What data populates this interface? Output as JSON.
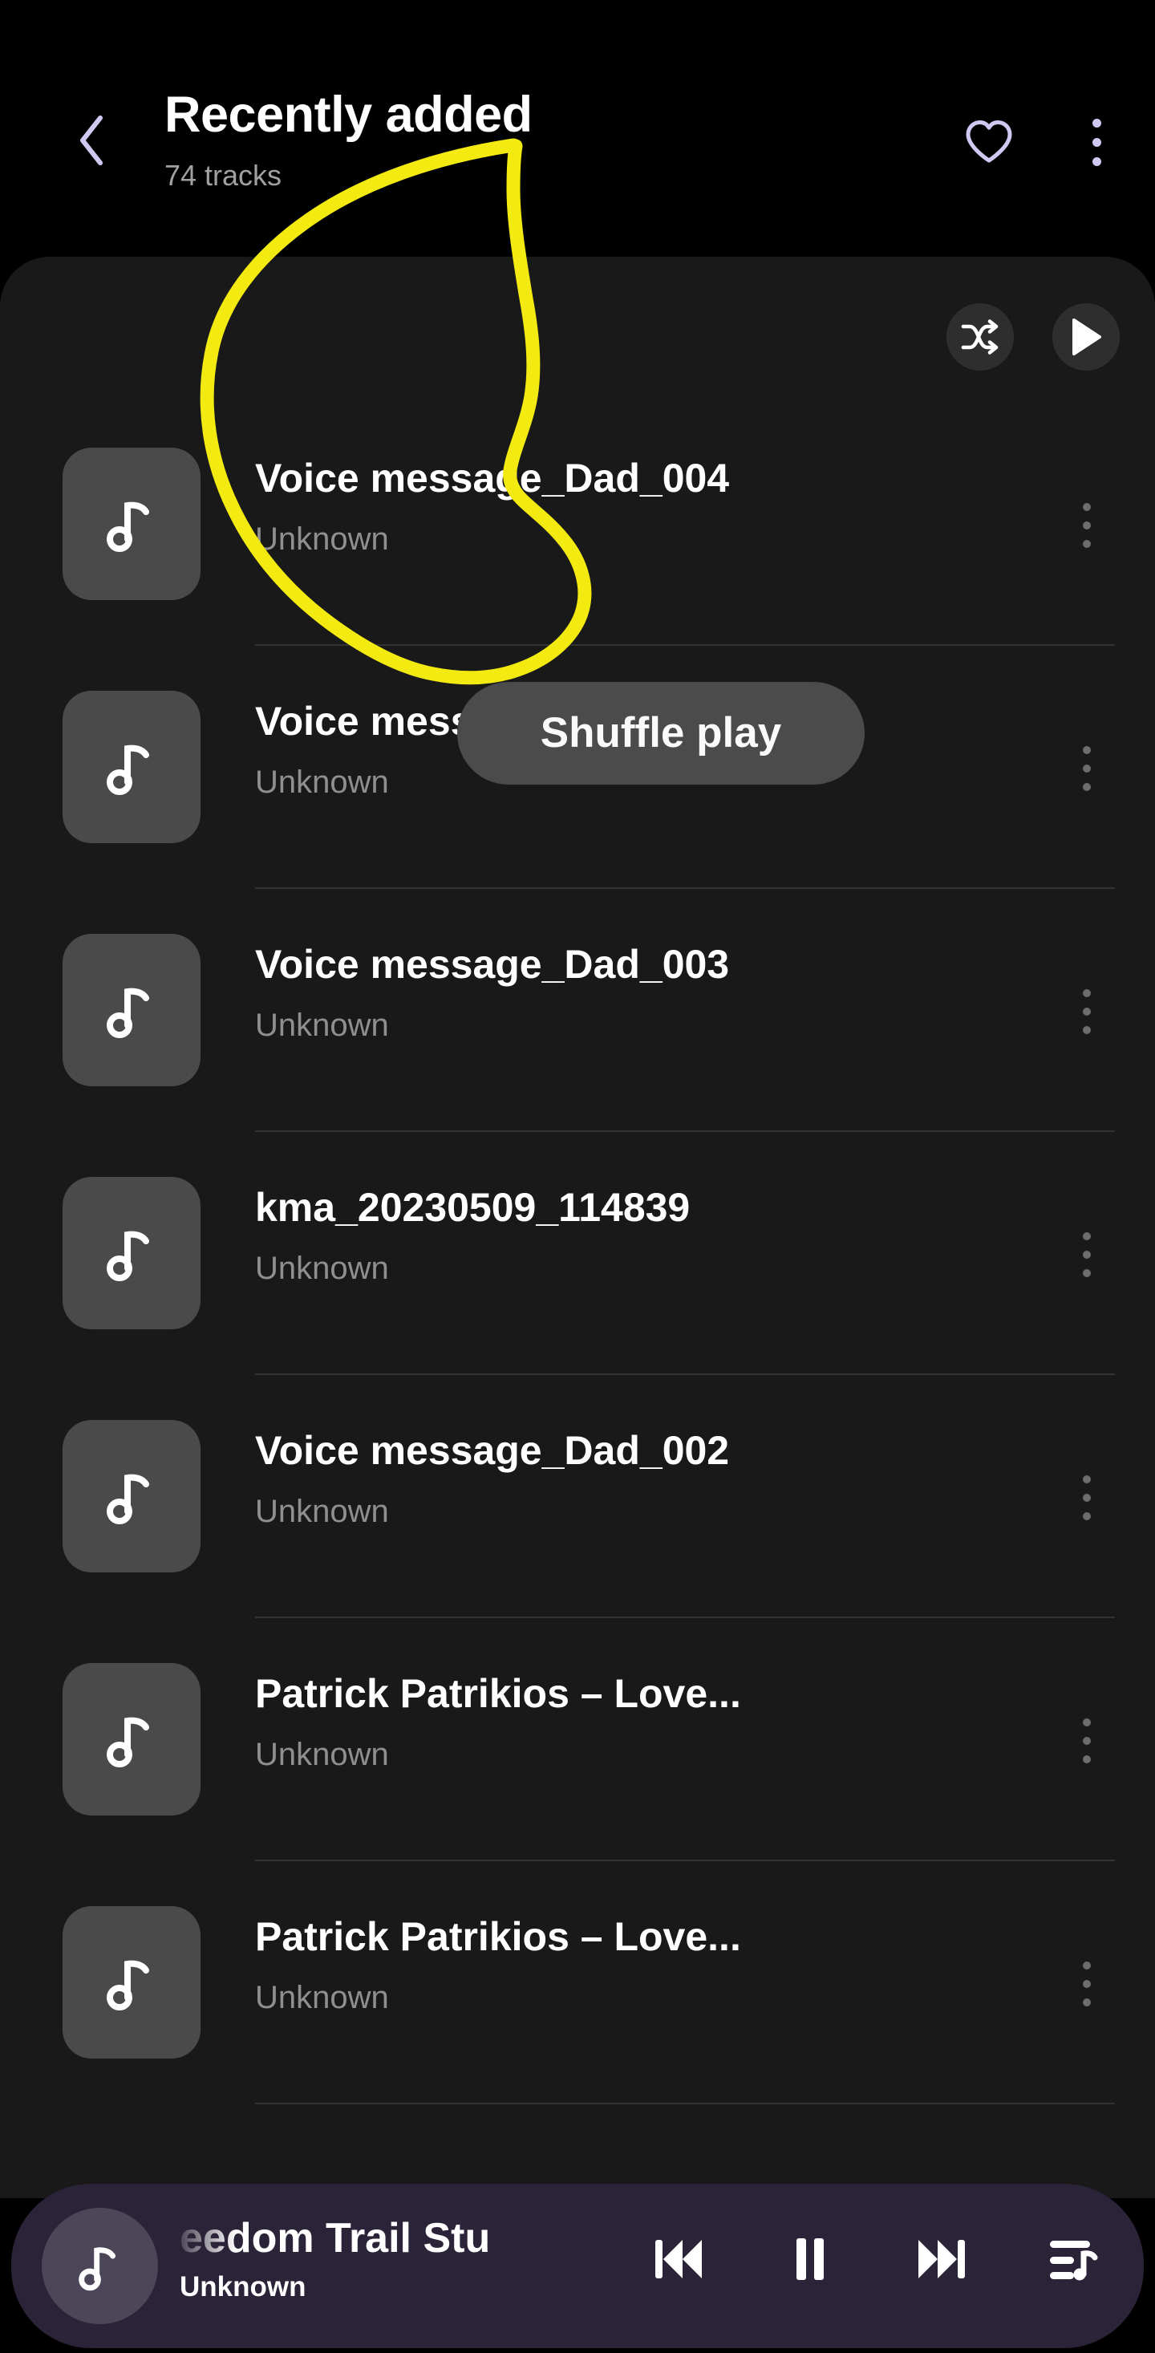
{
  "header": {
    "back_icon": "chevron-left-icon",
    "title": "Recently added",
    "subtitle": "74 tracks",
    "favorite_icon": "heart-outline-icon",
    "overflow_icon": "more-vertical-icon"
  },
  "card_actions": {
    "shuffle_icon": "shuffle-icon",
    "play_icon": "play-icon"
  },
  "tooltip": {
    "label": "Shuffle play"
  },
  "tracks": [
    {
      "title": "Voice message_Dad_004",
      "artist": "Unknown",
      "thumb_icon": "music-note-icon",
      "menu_icon": "more-vertical-icon"
    },
    {
      "title": "Voice message_New co...",
      "artist": "Unknown",
      "thumb_icon": "music-note-icon",
      "menu_icon": "more-vertical-icon"
    },
    {
      "title": "Voice message_Dad_003",
      "artist": "Unknown",
      "thumb_icon": "music-note-icon",
      "menu_icon": "more-vertical-icon"
    },
    {
      "title": "kma_20230509_114839",
      "artist": "Unknown",
      "thumb_icon": "music-note-icon",
      "menu_icon": "more-vertical-icon"
    },
    {
      "title": "Voice message_Dad_002",
      "artist": "Unknown",
      "thumb_icon": "music-note-icon",
      "menu_icon": "more-vertical-icon"
    },
    {
      "title": "Patrick Patrikios – Love...",
      "artist": "Unknown",
      "thumb_icon": "music-note-icon",
      "menu_icon": "more-vertical-icon"
    },
    {
      "title": "Patrick Patrikios – Love...",
      "artist": "Unknown",
      "thumb_icon": "music-note-icon",
      "menu_icon": "more-vertical-icon"
    }
  ],
  "mini_player": {
    "art_icon": "music-note-icon",
    "title": "eedom Trail Stu",
    "artist": "Unknown",
    "prev_icon": "skip-previous-icon",
    "pause_icon": "pause-icon",
    "next_icon": "skip-next-icon",
    "queue_icon": "queue-music-icon"
  },
  "annotation": {
    "color": "#f2ea10",
    "shape": "hand-drawn-circle"
  },
  "colors": {
    "page_background": "#000000",
    "card_background": "#191919",
    "accent_lavender": "#cfc9f2",
    "mini_player_background": "#2b2438",
    "highlight_yellow": "#f2ea10"
  }
}
